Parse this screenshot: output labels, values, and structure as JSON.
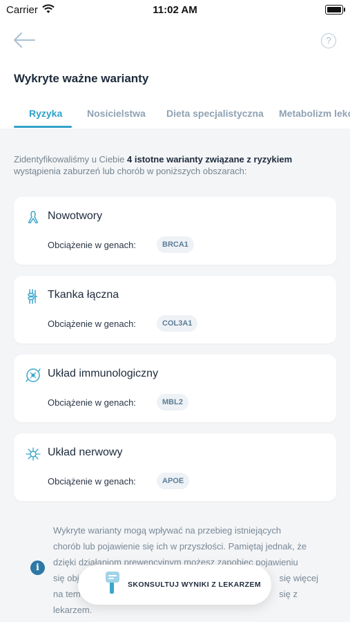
{
  "status_bar": {
    "carrier": "Carrier",
    "time": "11:02 AM"
  },
  "header": {
    "title": "Wykryte ważne warianty",
    "help_label": "?"
  },
  "tabs": [
    {
      "label": "Ryzyka",
      "active": true
    },
    {
      "label": "Nosicielstwa",
      "active": false
    },
    {
      "label": "Dieta specjalistyczna",
      "active": false
    },
    {
      "label": "Metabolizm leków",
      "active": false
    }
  ],
  "intro": {
    "before": "Zidentyfikowaliśmy u Ciebie ",
    "bold": "4 istotne warianty związane z ryzykiem",
    "after": " wystąpienia zaburzeń lub chorób w poniższych obszarach:"
  },
  "cards": [
    {
      "name": "Nowotwory",
      "icon": "ribbon-icon",
      "gene_label": "Obciążenie w genach:",
      "gene": "BRCA1"
    },
    {
      "name": "Tkanka łączna",
      "icon": "joint-icon",
      "gene_label": "Obciążenie w genach:",
      "gene": "COL3A1"
    },
    {
      "name": "Układ immunologiczny",
      "icon": "shield-virus-icon",
      "gene_label": "Obciążenie w genach:",
      "gene": "MBL2"
    },
    {
      "name": "Układ nerwowy",
      "icon": "neuron-icon",
      "gene_label": "Obciążenie w genach:",
      "gene": "APOE"
    }
  ],
  "footer_note": {
    "line1": "Wykryte warianty mogą wpływać na przebieg istniejących",
    "line2": "chorób lub pojawienie się ich w przyszłości. Pamiętaj jednak, że",
    "line3": "dzięki działaniom prewencyjnym możesz zapobiec pojawieniu",
    "line4_left": "się obj",
    "line4_right": "się więcej",
    "line5_left": "na tem",
    "line5_right": "się z",
    "line6": "lekarzem."
  },
  "info_icon": "i",
  "cta": {
    "label": "SKONSULTUJ WYNIKI Z LEKARZEM",
    "icon": "chat-doctor-icon"
  },
  "colors": {
    "accent": "#2ea0c8",
    "muted_tab": "#8fa2b3",
    "background": "#f3f5f7"
  }
}
